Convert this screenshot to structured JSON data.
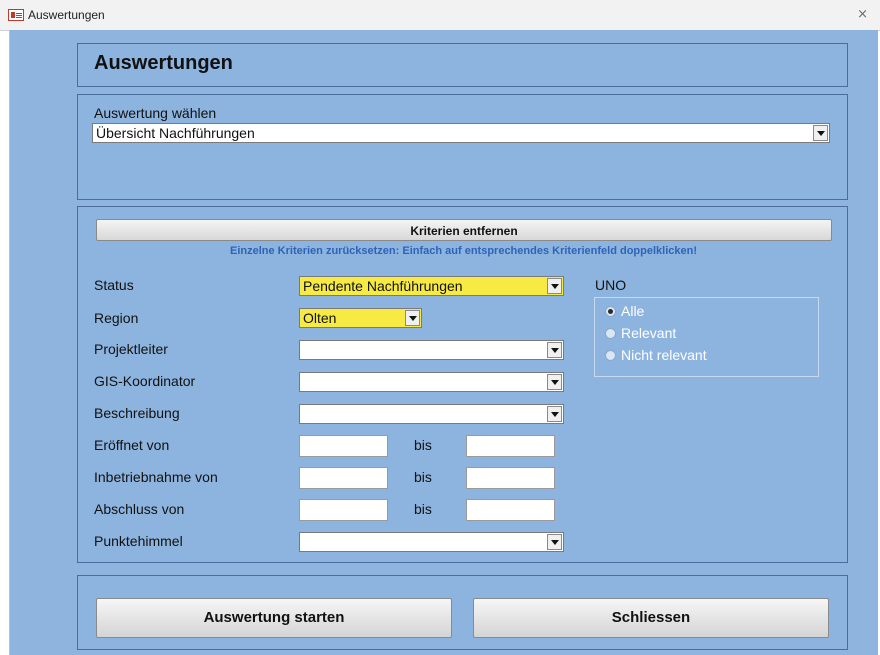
{
  "window": {
    "title": "Auswertungen",
    "close": "⨯"
  },
  "header": {
    "title": "Auswertungen"
  },
  "selection": {
    "label": "Auswertung wählen",
    "value": "Übersicht Nachführungen"
  },
  "criteria": {
    "remove_button": "Kriterien entfernen",
    "hint": "Einzelne Kriterien zurücksetzen: Einfach auf entsprechendes Kriterienfeld doppelklicken!",
    "status": {
      "label": "Status",
      "value": "Pendente Nachführungen"
    },
    "region": {
      "label": "Region",
      "value": "Olten"
    },
    "projektleiter": {
      "label": "Projektleiter",
      "value": ""
    },
    "gis": {
      "label": "GIS-Koordinator",
      "value": ""
    },
    "beschreibung": {
      "label": "Beschreibung",
      "value": ""
    },
    "eroeffnet": {
      "label": "Eröffnet von",
      "bis": "bis"
    },
    "inbetriebnahme": {
      "label": "Inbetriebnahme von",
      "bis": "bis"
    },
    "abschluss": {
      "label": "Abschluss von",
      "bis": "bis"
    },
    "punktehimmel": {
      "label": "Punktehimmel",
      "value": ""
    }
  },
  "uno": {
    "label": "UNO",
    "options": [
      "Alle",
      "Relevant",
      "Nicht relevant"
    ],
    "selected": "Alle"
  },
  "footer": {
    "start_label": "Auswertung starten",
    "close_label": "Schliessen"
  },
  "colors": {
    "background": "#8fb4de",
    "highlight": "#f7ea45",
    "hint": "#2f63b5"
  }
}
